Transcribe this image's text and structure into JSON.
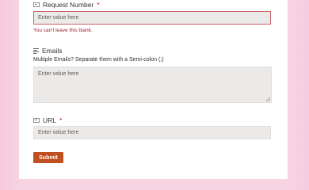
{
  "form": {
    "request_number": {
      "label": "Request Number",
      "required_mark": "*",
      "placeholder": "Enter value here",
      "error": "You can't leave this blank."
    },
    "emails": {
      "label": "Emails",
      "help": "Multiple Emails? Separate them with a Semi-colon (;)",
      "placeholder": "Enter value here"
    },
    "url": {
      "label": "URL",
      "required_mark": "*",
      "placeholder": "Enter value here"
    },
    "submit_label": "Submit"
  },
  "colors": {
    "accent": "#c0501f",
    "error": "#a4262c",
    "background": "#f7d4e2"
  },
  "icons": {
    "request_number": "textbox-icon",
    "emails": "multiline-text-icon",
    "url": "textbox-icon"
  }
}
